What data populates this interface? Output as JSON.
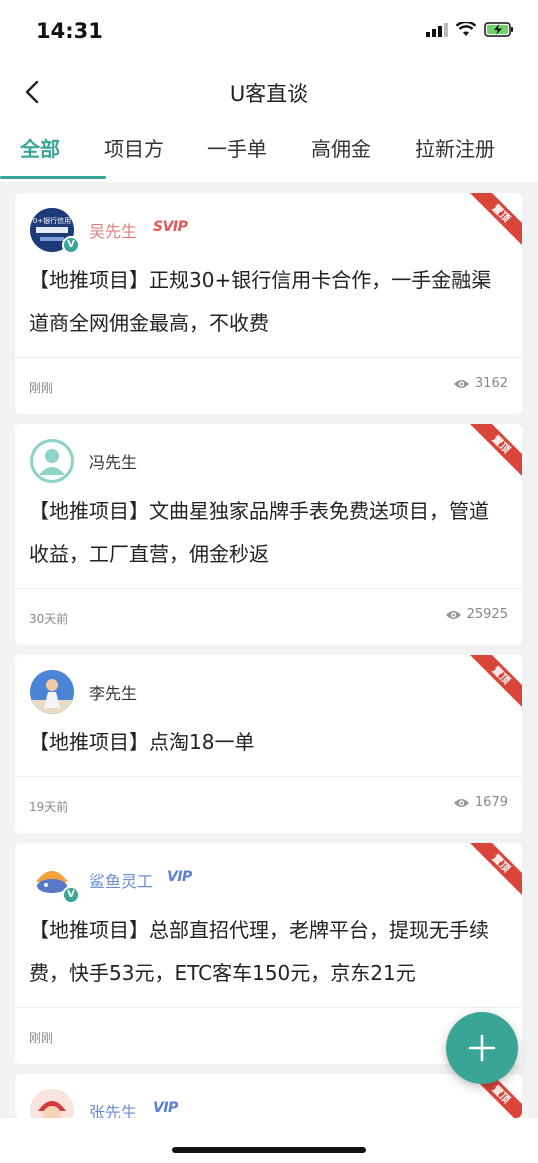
{
  "status_bar": {
    "time": "14:31"
  },
  "nav": {
    "title": "U客直谈"
  },
  "tabs": [
    {
      "label": "全部",
      "active": true
    },
    {
      "label": "项目方",
      "active": false
    },
    {
      "label": "一手单",
      "active": false
    },
    {
      "label": "高佣金",
      "active": false
    },
    {
      "label": "拉新注册",
      "active": false
    }
  ],
  "posts": [
    {
      "user": "吴先生",
      "badge": "SVIP",
      "content": "【地推项目】正规30+银行信用卡合作，一手金融渠道商全网佣金最高，不收费",
      "time": "刚刚",
      "views": "3162",
      "ribbon": "置顶",
      "avatar_text": "0+银行信用"
    },
    {
      "user": "冯先生",
      "badge": "",
      "content": "【地推项目】文曲星独家品牌手表免费送项目，管道收益，工厂直营，佣金秒返",
      "time": "30天前",
      "views": "25925",
      "ribbon": "置顶"
    },
    {
      "user": "李先生",
      "badge": "",
      "content": "【地推项目】点淘18一单",
      "time": "19天前",
      "views": "1679",
      "ribbon": "置顶"
    },
    {
      "user": "鲨鱼灵工",
      "badge": "VIP",
      "content": "【地推项目】总部直招代理，老牌平台，提现无手续费，快手53元，ETC客车150元，京东21元",
      "time": "刚刚",
      "views": "",
      "ribbon": "置顶"
    },
    {
      "user": "张先生",
      "badge": "VIP",
      "ribbon": "置顶"
    }
  ],
  "colors": {
    "accent": "#3aa597",
    "ribbon": "#d9453b",
    "svip": "#e25656",
    "vip": "#5b7fd8"
  },
  "icons": {
    "back": "chevron-left-icon",
    "views": "eye-icon",
    "fab": "plus-icon"
  }
}
